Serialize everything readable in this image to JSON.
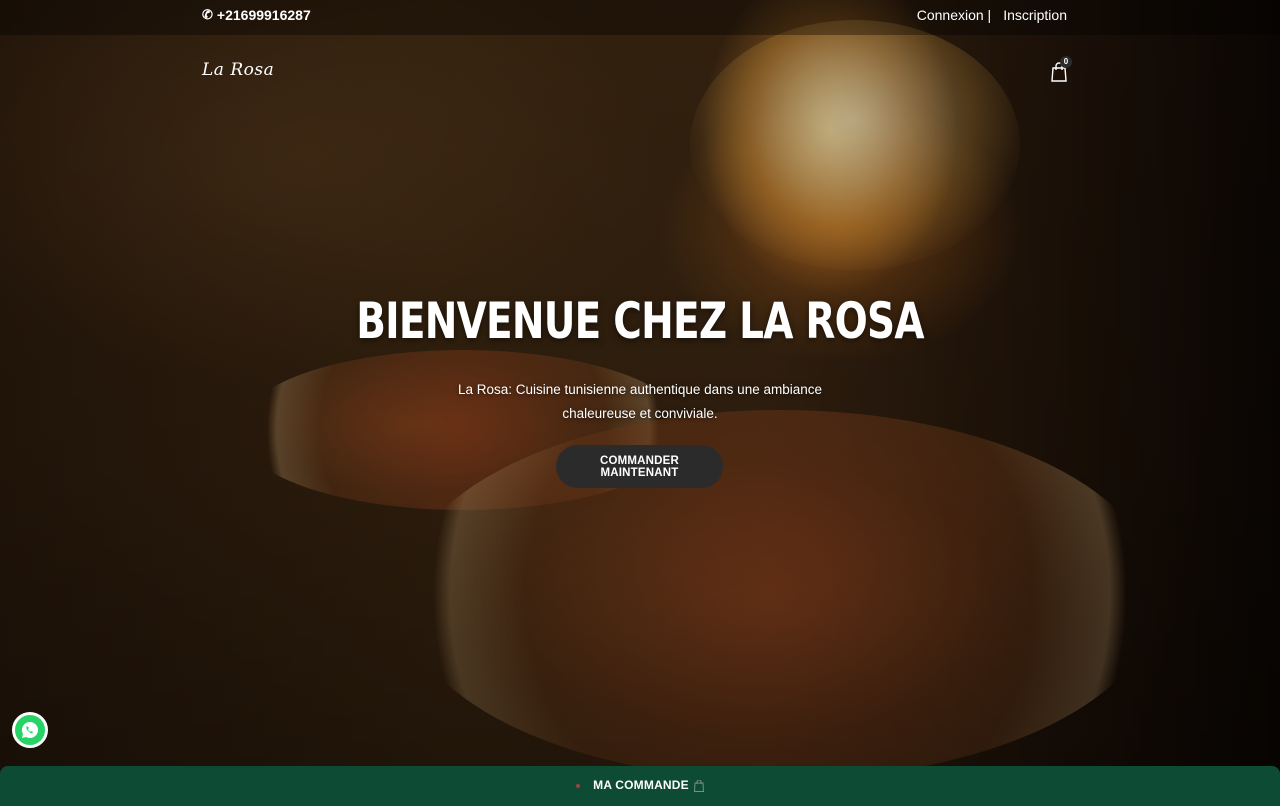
{
  "topbar": {
    "phone": "+21699916287",
    "phone_icon": "phone-icon",
    "login_label": "Connexion |",
    "register_label": "Inscription"
  },
  "nav": {
    "logo": "La Rosa",
    "cart_icon": "shopping-bag-icon",
    "cart_count": "0"
  },
  "hero": {
    "title": "BIENVENUE CHEZ LA ROSA",
    "subtitle": "La Rosa: Cuisine tunisienne authentique dans une ambiance chaleureuse et conviviale.",
    "cta_label": "COMMANDER MAINTENANT"
  },
  "whatsapp": {
    "icon": "whatsapp-icon"
  },
  "order_bar": {
    "label": "MA COMMANDE",
    "icon": "shopping-bag-icon",
    "color": "#0e4b35"
  }
}
